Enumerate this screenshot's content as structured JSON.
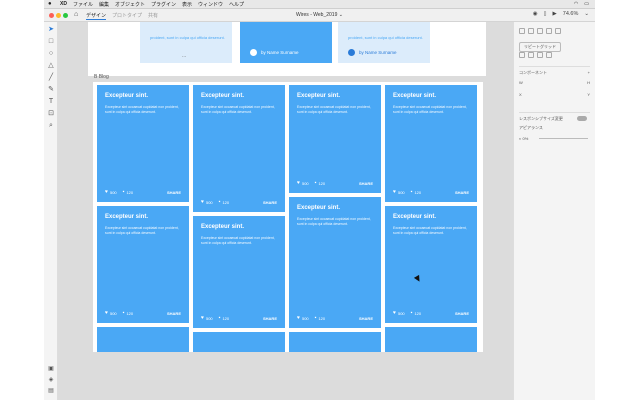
{
  "menubar": {
    "app": "XD",
    "items": [
      "ファイル",
      "編集",
      "オブジェクト",
      "プラグイン",
      "表示",
      "ウィンドウ",
      "ヘルプ"
    ]
  },
  "titlebar": {
    "tabs": [
      "デザイン",
      "プロトタイプ",
      "共有"
    ],
    "active_tab": "デザイン",
    "doc_title": "Wires - Web_2019",
    "zoom": "74.6%"
  },
  "top_cards": {
    "text": "proident, sunt in culpa qui officia deserunt.",
    "more": "...",
    "author": "by Name Surname"
  },
  "frame_label": "B Blog",
  "cards": [
    {
      "title": "Excepteur sint.",
      "body": "Excepteur sint occaecat cupidatat non proident, sunt in culpa qui officia deserunt.",
      "likes": "500",
      "comments": "120",
      "share": "SHARE"
    },
    {
      "title": "Excepteur sint.",
      "body": "Excepteur sint occaecat cupidatat non proident, sunt in culpa qui officia deserunt.",
      "likes": "500",
      "comments": "120",
      "share": "SHARE"
    },
    {
      "title": "Excepteur sint.",
      "body": "Excepteur sint occaecat cupidatat non proident, sunt in culpa qui officia deserunt.",
      "likes": "500",
      "comments": "120",
      "share": "SHARE"
    },
    {
      "title": "Excepteur sint.",
      "body": "Excepteur sint occaecat cupidatat non proident, sunt in culpa qui officia deserunt.",
      "likes": "500",
      "comments": "120",
      "share": "SHARE"
    },
    {
      "title": "Excepteur sint.",
      "body": "Excepteur sint occaecat cupidatat non proident, sunt in culpa qui officia deserunt.",
      "likes": "500",
      "comments": "120",
      "share": "SHARE"
    },
    {
      "title": "Excepteur sint.",
      "body": "Excepteur sint occaecat cupidatat non proident, sunt in culpa qui officia deserunt.",
      "likes": "500",
      "comments": "120",
      "share": "SHARE"
    },
    {
      "title": "Excepteur sint.",
      "body": "Excepteur sint occaecat cupidatat non proident, sunt in culpa qui officia deserunt.",
      "likes": "500",
      "comments": "120",
      "share": "SHARE"
    },
    {
      "title": "Excepteur sint.",
      "body": "Excepteur sint occaecat cupidatat non proident, sunt in culpa qui officia deserunt.",
      "likes": "500",
      "comments": "120",
      "share": "SHARE"
    }
  ],
  "inspector": {
    "repeat_grid": "リピートグリッド",
    "component": "コンポーネント",
    "w": "W",
    "h": "H",
    "x": "X",
    "y": "Y",
    "responsive": "レスポンシブサイズ変更",
    "appearance": "アピアランス",
    "opacity": "0%"
  },
  "colors": {
    "card_blue": "#4aa8f5",
    "canvas": "#dcdcdc",
    "accent": "#2a7bd8"
  }
}
